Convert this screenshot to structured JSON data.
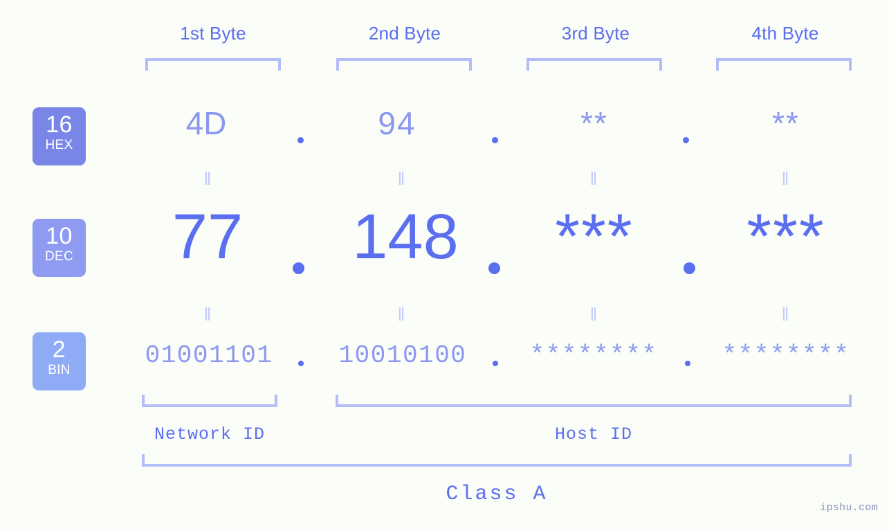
{
  "page": {
    "background_color": "#fbfdf8",
    "accent_color": "#5a6ef0",
    "accent_light_color": "#8b98ef",
    "bracket_color": "#b3bdf7",
    "watermark": "ipshu.com"
  },
  "columns": [
    {
      "header": "1st Byte"
    },
    {
      "header": "2nd Byte"
    },
    {
      "header": "3rd Byte"
    },
    {
      "header": "4th Byte"
    }
  ],
  "rows": [
    {
      "badge_number": "16",
      "badge_name": "HEX",
      "badge_color": "#7986e8",
      "values": [
        "4D",
        "94",
        "**",
        "**"
      ]
    },
    {
      "badge_number": "10",
      "badge_name": "DEC",
      "badge_color": "#8e9bf0",
      "values": [
        "77",
        "148",
        "***",
        "***"
      ]
    },
    {
      "badge_number": "2",
      "badge_name": "BIN",
      "badge_color": "#8fabf5",
      "values": [
        "01001101",
        "10010100",
        "********",
        "********"
      ]
    }
  ],
  "separators": {
    "dot": ".",
    "equals_mark": "‖"
  },
  "id_sections": [
    {
      "label": "Network ID"
    },
    {
      "label": "Host ID"
    }
  ],
  "class_section": {
    "label": "Class A"
  }
}
